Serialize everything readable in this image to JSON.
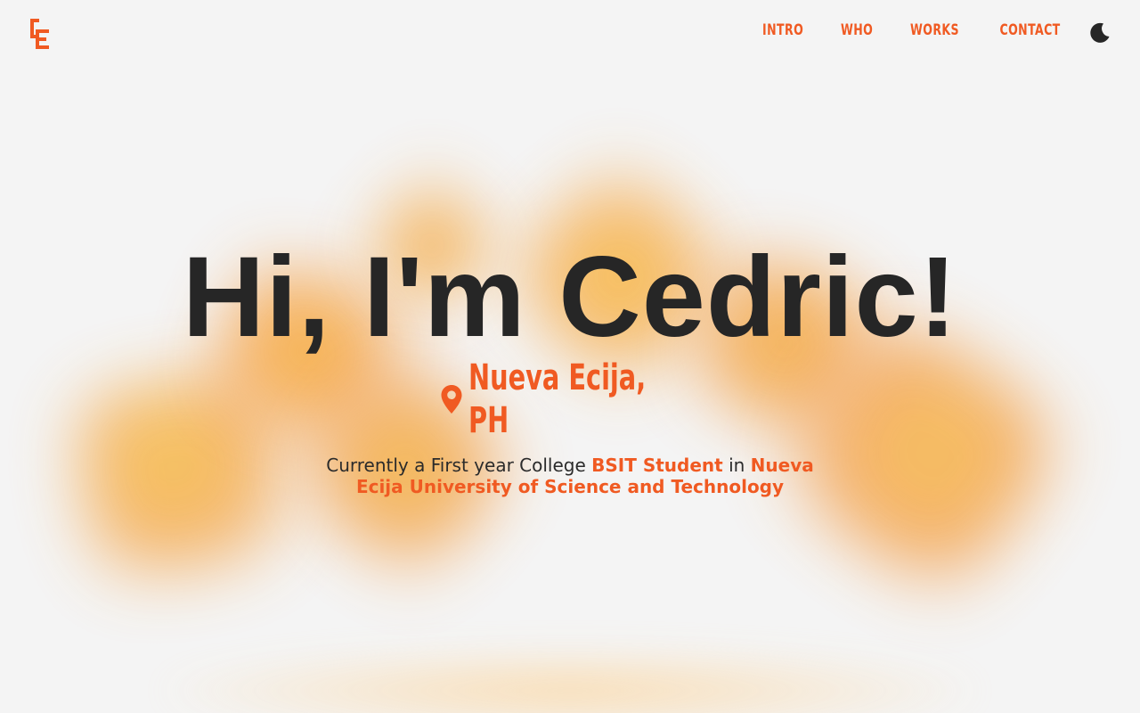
{
  "brand": {
    "logo_icon": "ce-monogram-logo",
    "accent_color": "#f05a22",
    "text_color": "#262626",
    "background_color": "#f4f4f4"
  },
  "nav": {
    "items": [
      {
        "label": "INTRO"
      },
      {
        "label": "WHO"
      },
      {
        "label": "WORKS"
      },
      {
        "label": "CONTACT"
      }
    ],
    "theme_toggle_icon": "moon-icon"
  },
  "hero": {
    "title": "Hi, I'm Cedric!",
    "location_icon": "map-pin-icon",
    "location": "Nueva Ecija, PH",
    "description": {
      "part1": "Currently a First year College ",
      "highlight1": "BSIT Student",
      "part2": " in ",
      "highlight2": "Nueva Ecija University of Science and Technology"
    }
  }
}
